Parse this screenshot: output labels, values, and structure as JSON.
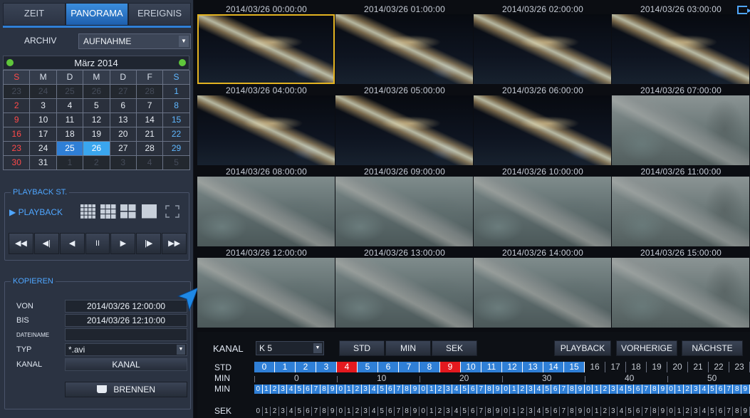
{
  "mode_tabs": [
    "ZEIT",
    "PANORAMA",
    "EREIGNIS"
  ],
  "archiv": {
    "label": "ARCHIV",
    "value": "AUFNAHME"
  },
  "calendar": {
    "title": "März  2014",
    "weekdays": [
      "S",
      "M",
      "D",
      "M",
      "D",
      "F",
      "S"
    ],
    "days": [
      "23",
      "24",
      "25",
      "26",
      "27",
      "28",
      "1",
      "2",
      "3",
      "4",
      "5",
      "6",
      "7",
      "8",
      "9",
      "10",
      "11",
      "12",
      "13",
      "14",
      "15",
      "16",
      "17",
      "18",
      "19",
      "20",
      "21",
      "22",
      "23",
      "24",
      "25",
      "26",
      "27",
      "28",
      "29",
      "30",
      "31",
      "1",
      "2",
      "3",
      "4",
      "5"
    ],
    "selected_a": "25",
    "selected_b": "26"
  },
  "playback": {
    "title": "PLAYBACK ST.",
    "mode_label": "PLAYBACK",
    "controls": [
      "◀◀",
      "◀|",
      "◀",
      "II",
      "▶",
      "|▶",
      "▶▶"
    ]
  },
  "kopieren": {
    "title": "KOPIEREN",
    "von_label": "VON",
    "von_value": "2014/03/26 12:00:00",
    "bis_label": "BIS",
    "bis_value": "2014/03/26 12:10:00",
    "dateiname_label": "DATEINAME",
    "dateiname_value": "",
    "typ_label": "TYP",
    "typ_value": "*.avi",
    "kanal_label": "KANAL",
    "kanal_value": "KANAL",
    "brennen_label": "BRENNEN"
  },
  "thumbnails": [
    "2014/03/26 00:00:00",
    "2014/03/26 01:00:00",
    "2014/03/26 02:00:00",
    "2014/03/26 03:00:00",
    "2014/03/26 04:00:00",
    "2014/03/26 05:00:00",
    "2014/03/26 06:00:00",
    "2014/03/26 07:00:00",
    "2014/03/26 08:00:00",
    "2014/03/26 09:00:00",
    "2014/03/26 10:00:00",
    "2014/03/26 11:00:00",
    "2014/03/26 12:00:00",
    "2014/03/26 13:00:00",
    "2014/03/26 14:00:00",
    "2014/03/26 15:00:00"
  ],
  "selected_thumbnail": "2014/03/26 00:00:00",
  "bottom": {
    "kanal_label": "KANAL",
    "kanal_value": "K 5",
    "std_btn": "STD",
    "min_btn": "MIN",
    "sek_btn": "SEK",
    "playback_btn": "PLAYBACK",
    "vorherige_btn": "VORHERIGE",
    "naechste_btn": "NÄCHSTE",
    "std_label": "STD",
    "min_label": "MIN",
    "min_label2": "MIN",
    "sek_label": "SEK",
    "hours": [
      "0",
      "1",
      "2",
      "3",
      "4",
      "5",
      "6",
      "7",
      "8",
      "9",
      "10",
      "11",
      "12",
      "13",
      "14",
      "15",
      "16",
      "17",
      "18",
      "19",
      "20",
      "21",
      "22",
      "23"
    ],
    "hour_status": [
      "rec",
      "rec",
      "rec",
      "rec",
      "evt",
      "rec",
      "rec",
      "rec",
      "rec",
      "evt",
      "rec",
      "rec",
      "rec",
      "rec",
      "rec",
      "rec",
      "none",
      "none",
      "none",
      "none",
      "none",
      "none",
      "none",
      "none"
    ],
    "minute_marks": [
      "0",
      "10",
      "20",
      "30",
      "40",
      "50"
    ]
  },
  "colors": {
    "accent": "#2f7fd6",
    "event": "#e3191f",
    "selection": "#e3b321",
    "calendar_nav": "#5fc63b"
  }
}
